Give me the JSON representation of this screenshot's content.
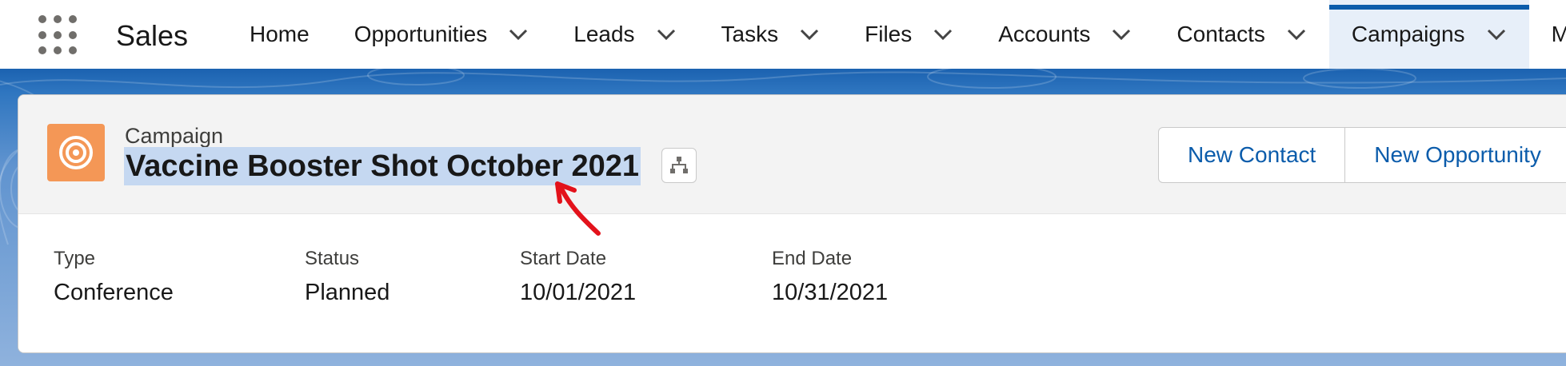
{
  "app": {
    "name": "Sales"
  },
  "nav": {
    "items": [
      {
        "label": "Home",
        "has_menu": false
      },
      {
        "label": "Opportunities",
        "has_menu": true
      },
      {
        "label": "Leads",
        "has_menu": true
      },
      {
        "label": "Tasks",
        "has_menu": true
      },
      {
        "label": "Files",
        "has_menu": true
      },
      {
        "label": "Accounts",
        "has_menu": true
      },
      {
        "label": "Contacts",
        "has_menu": true
      },
      {
        "label": "Campaigns",
        "has_menu": true,
        "active": true
      },
      {
        "label": "M",
        "has_menu": false
      }
    ]
  },
  "record": {
    "object_type": "Campaign",
    "title": "Vaccine Booster Shot October 2021",
    "icon": "target-icon",
    "hierarchy_icon": "hierarchy-icon"
  },
  "actions": {
    "new_contact": "New Contact",
    "new_opportunity": "New Opportunity"
  },
  "fields": [
    {
      "label": "Type",
      "value": "Conference"
    },
    {
      "label": "Status",
      "value": "Planned"
    },
    {
      "label": "Start Date",
      "value": "10/01/2021"
    },
    {
      "label": "End Date",
      "value": "10/31/2021"
    }
  ],
  "colors": {
    "brand_blue": "#0b5cab",
    "campaign_orange": "#f49756",
    "title_highlight": "#c5d8f1",
    "annotation_red": "#e3121b"
  }
}
